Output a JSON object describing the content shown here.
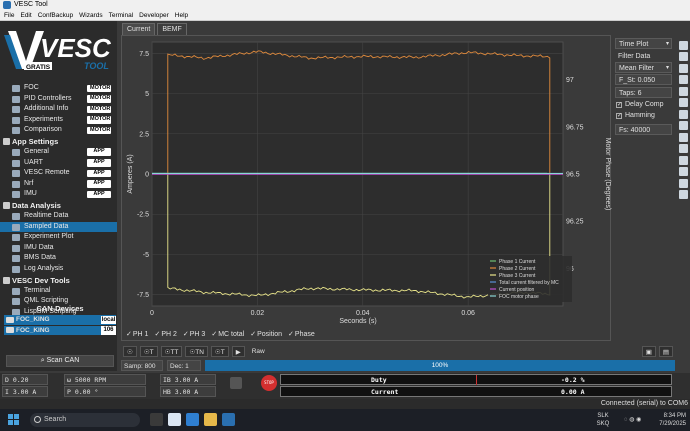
{
  "window": {
    "title": "VESC Tool"
  },
  "menu": [
    "File",
    "Edit",
    "ConfBackup",
    "Wizards",
    "Terminal",
    "Developer",
    "Help"
  ],
  "logo": {
    "text": "VESC",
    "subtext": "TOOL",
    "badge": "GRATIS"
  },
  "sidebar": {
    "motor_items": [
      {
        "label": "FOC",
        "tag": "MOTOR"
      },
      {
        "label": "PID Controllers",
        "tag": "MOTOR"
      },
      {
        "label": "Additional Info",
        "tag": "MOTOR"
      },
      {
        "label": "Experiments",
        "tag": "MOTOR"
      },
      {
        "label": "Comparison",
        "tag": "MOTOR"
      }
    ],
    "app_section": "App Settings",
    "app_items": [
      {
        "label": "General",
        "tag": "APP"
      },
      {
        "label": "UART",
        "tag": "APP"
      },
      {
        "label": "VESC Remote",
        "tag": "APP"
      },
      {
        "label": "Nrf",
        "tag": "APP"
      },
      {
        "label": "IMU",
        "tag": "APP"
      }
    ],
    "data_section": "Data Analysis",
    "data_items": [
      "Realtime Data",
      "Sampled Data",
      "Experiment Plot",
      "IMU Data",
      "BMS Data",
      "Log Analysis"
    ],
    "dev_section": "VESC Dev Tools",
    "dev_items": [
      "Terminal",
      "QML Scripting",
      "LispBM Scripting"
    ]
  },
  "can": {
    "title": "CAN-Devices",
    "devices": [
      {
        "name": "FOC_KING",
        "tag": "local"
      },
      {
        "name": "FOC_KING",
        "tag": "106"
      }
    ],
    "scan_label": "Scan CAN"
  },
  "tabs": [
    "Current",
    "BEMF"
  ],
  "chart_data": {
    "type": "line",
    "xlabel": "Seconds (s)",
    "ylabel": "Amperes (A)",
    "y2label": "Motor Phase (Degrees)",
    "xlim": [
      0,
      0.078
    ],
    "ylim": [
      -8.2,
      8.2
    ],
    "y2lim": [
      95.8,
      97.2
    ],
    "x_ticks": [
      "0",
      "0.02",
      "0.04",
      "0.06"
    ],
    "y_ticks": [
      "7.5",
      "5",
      "2.5",
      "0",
      "-2.5",
      "-5",
      "-7.5"
    ],
    "y2_ticks": [
      "97",
      "96.75",
      "96.5",
      "96.25",
      "96"
    ],
    "legend_position": "bottom-right",
    "series": [
      {
        "name": "Phase 1 Current",
        "color": "#6fbf73",
        "x": [
          0,
          0.005,
          0.02,
          0.04,
          0.06,
          0.075
        ],
        "y": [
          0.05,
          0.05,
          0.05,
          0.05,
          0.05,
          0.05
        ]
      },
      {
        "name": "Phase 2 Current",
        "color": "#e08a3c",
        "x": [
          0.003,
          0.01,
          0.02,
          0.03,
          0.04,
          0.05,
          0.06,
          0.07,
          0.0755
        ],
        "y": [
          7.4,
          7.2,
          7.6,
          7.2,
          7.3,
          7.25,
          7.55,
          7.35,
          7.3
        ]
      },
      {
        "name": "Phase 3 Current",
        "color": "#e8e48a",
        "x": [
          0.003,
          0.01,
          0.02,
          0.03,
          0.04,
          0.05,
          0.06,
          0.07,
          0.0755
        ],
        "y": [
          -7.1,
          -7.35,
          -7.55,
          -7.1,
          -7.2,
          -7.25,
          -7.65,
          -7.35,
          -7.45
        ]
      },
      {
        "name": "Total current filtered by MC",
        "color": "#5b8fd4",
        "x": [
          0,
          0.078
        ],
        "y": [
          0.02,
          0.02
        ]
      },
      {
        "name": "Current position",
        "color": "#c04fd0",
        "x": [
          0,
          0.078
        ],
        "y": [
          -0.02,
          -0.02
        ]
      },
      {
        "name": "FOC motor phase",
        "color": "#8ad6d6",
        "x": [
          0,
          0.078
        ],
        "y": [
          0.03,
          0.03
        ]
      }
    ]
  },
  "rightpanel": {
    "plot_mode": "Time Plot",
    "filter_label": "Filter Data",
    "filter_type": "Mean Filter",
    "f_st": "F_St: 0.050",
    "taps": "Taps: 6",
    "delay_comp": "Delay Comp",
    "hamming": "Hamming",
    "fs": "Fs: 40000"
  },
  "series_toggles": [
    "PH 1",
    "PH 2",
    "PH 3",
    "MC total",
    "Position",
    "Phase"
  ],
  "toolbar": {
    "buttons": [
      "☉",
      "☉T",
      "☉TT",
      "☉TN",
      "☉T",
      "▶"
    ],
    "raw_label": "Raw"
  },
  "sampling": {
    "samp": "Samp: 800",
    "dec": "Dec: 1",
    "progress": 100,
    "progress_label": "100%"
  },
  "readouts": {
    "d": "D 0.20",
    "w": "ω 5000 RPM",
    "ib": "IB 3.00 A",
    "i": "I 3.00 A",
    "p": "P 0.00 °",
    "hb": "HB 3.00 A",
    "duty_label": "Duty",
    "duty_value": "-0.2 %",
    "current_label": "Current",
    "current_value": "0.00 A"
  },
  "status": "Connected (serial) to COM6",
  "taskbar": {
    "search": "Search",
    "tray_lang": "SLK",
    "tray_lang2": "SKQ",
    "time": "8:34 PM",
    "date": "7/29/2025"
  }
}
